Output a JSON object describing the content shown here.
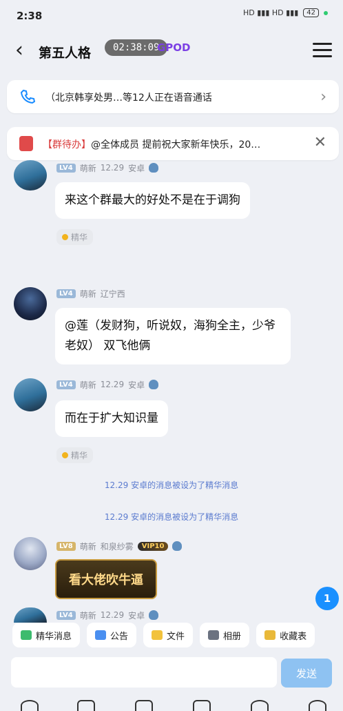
{
  "status": {
    "time": "2:38",
    "battery": "42",
    "icons_text": "HD ▮▮▮ HD ▮▮▮"
  },
  "header": {
    "title": "第五人格",
    "badge": "02:38:09",
    "tag": "GPOD"
  },
  "notices": [
    {
      "icon": "phone-icon",
      "text": "（北京韩享处男…等12人正在语音通话"
    },
    {
      "icon": "gift-icon",
      "tag": "【群待办】",
      "text": "@全体成员  提前祝大家新年快乐，20…"
    }
  ],
  "messages": [
    {
      "level": "LV4",
      "rank": "萌新",
      "time": "12.29",
      "region": "安卓",
      "text": "来这个群最大的好处不是在于调狗",
      "essence_label": "精华"
    },
    {
      "level": "LV4",
      "rank": "萌新",
      "region": "辽宁西",
      "text": "@莲（发财狗，听说奴，海狗全主，少爷老奴） 双飞他俩"
    },
    {
      "level": "LV4",
      "rank": "萌新",
      "time": "12.29",
      "region": "安卓",
      "text": "而在于扩大知识量",
      "essence_label": "精华"
    },
    {
      "level": "LV8",
      "rank": "萌新",
      "name": "和泉纱雾",
      "vip": "VIP10",
      "text": "看大佬吹牛逼"
    },
    {
      "level": "LV4",
      "rank": "萌新",
      "time": "12.29",
      "region": "安卓"
    }
  ],
  "system_notes": [
    "12.29 安卓的消息被设为了精华消息",
    "12.29 安卓的消息被设为了精华消息"
  ],
  "float_badge": "1",
  "toolbar": {
    "items": [
      "精华消息",
      "公告",
      "文件",
      "相册",
      "收藏表"
    ]
  },
  "input": {
    "placeholder": "",
    "send_label": "发送"
  }
}
